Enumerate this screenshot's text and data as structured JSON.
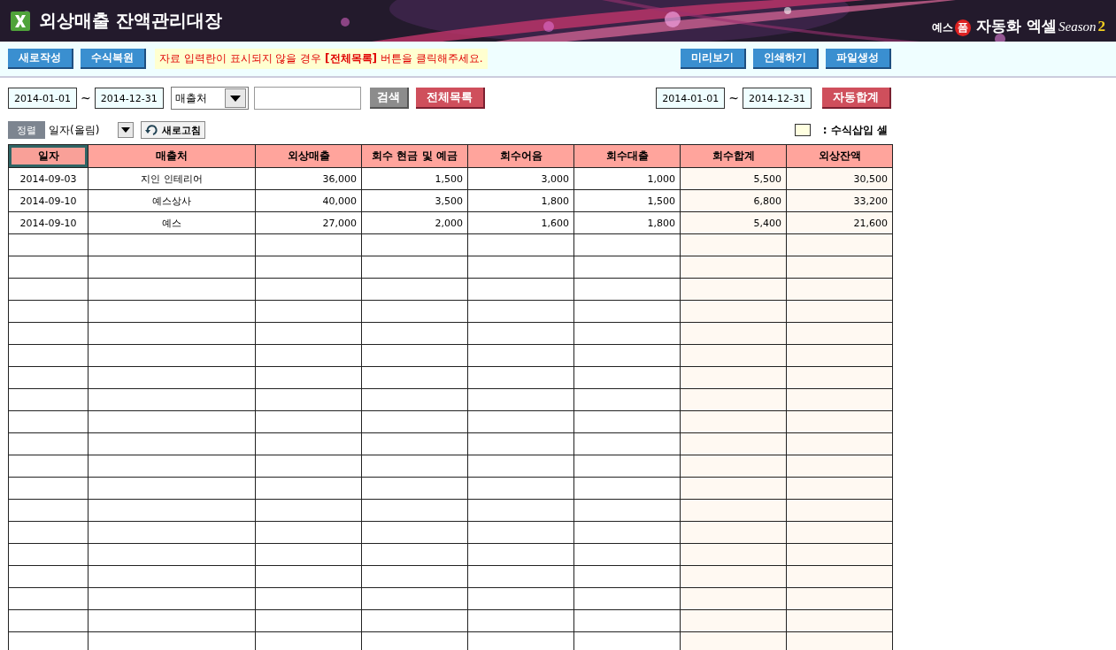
{
  "header": {
    "title": "외상매출 잔액관리대장",
    "logo": {
      "prefix": "예스",
      "stamp": "폼",
      "name": "자동화 엑셀",
      "season": "Season",
      "number": "2"
    }
  },
  "toolbar": {
    "left_buttons": [
      "새로작성",
      "수식복원"
    ],
    "notice": "자료 입력란이 표시되지  않을 경우 **[전체목록]** 버튼을 클릭해주세요.",
    "right_buttons": [
      "미리보기",
      "인쇄하기",
      "파일생성"
    ]
  },
  "search": {
    "date_from": "2014-01-01",
    "tilde": "~",
    "date_to": "2014-12-31",
    "field": "매출처",
    "search_button": "검색",
    "all_button": "전체목록"
  },
  "summary": {
    "date_from": "2014-01-01",
    "tilde": "~",
    "date_to": "2014-12-31",
    "button": "자동합계"
  },
  "sort": {
    "label": "정렬",
    "value": "일자(올림)",
    "refresh": "새로고침"
  },
  "legend": {
    "text": ": 수식삽입 셀"
  },
  "table": {
    "columns": [
      {
        "label": "일자",
        "formula": false,
        "selected": true
      },
      {
        "label": "매출처",
        "formula": false,
        "selected": false
      },
      {
        "label": "외상매출",
        "formula": false,
        "selected": false
      },
      {
        "label": "회수 현금 및 예금",
        "formula": false,
        "selected": false
      },
      {
        "label": "회수어음",
        "formula": false,
        "selected": false
      },
      {
        "label": "회수대출",
        "formula": false,
        "selected": false
      },
      {
        "label": "회수합계",
        "formula": true,
        "selected": false
      },
      {
        "label": "외상잔액",
        "formula": true,
        "selected": false
      }
    ],
    "rows": [
      [
        "2014-09-03",
        "지인 인테리어",
        "36,000",
        "1,500",
        "3,000",
        "1,000",
        "5,500",
        "30,500"
      ],
      [
        "2014-09-10",
        "예스상사",
        "40,000",
        "3,500",
        "1,800",
        "1,500",
        "6,800",
        "33,200"
      ],
      [
        "2014-09-10",
        "예스",
        "27,000",
        "2,000",
        "1,600",
        "1,800",
        "5,400",
        "21,600"
      ]
    ]
  }
}
